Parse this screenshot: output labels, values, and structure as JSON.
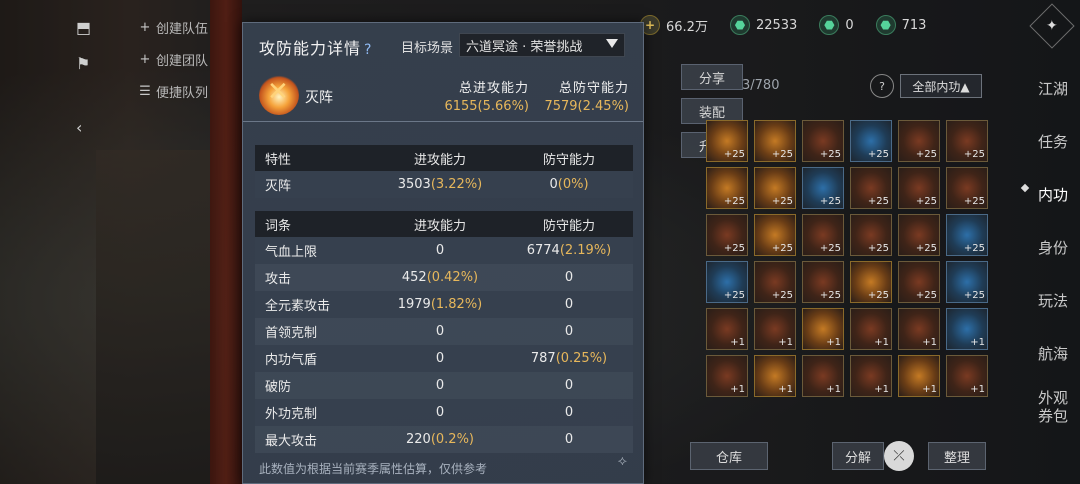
{
  "left_menu": [
    {
      "icon": "+",
      "label": "创建队伍"
    },
    {
      "icon": "+",
      "label": "创建团队"
    },
    {
      "icon": "☰",
      "label": "便捷队列"
    }
  ],
  "topbar": {
    "items": [
      {
        "icon": "+",
        "value": "66.2万"
      },
      {
        "icon": "⬣",
        "value": "22533"
      },
      {
        "icon": "⬣",
        "value": "0"
      },
      {
        "icon": "⬣",
        "value": "713"
      }
    ]
  },
  "right_nav": [
    "江湖",
    "任务",
    "内功",
    "身份",
    "玩法",
    "航海",
    "外观\n券包"
  ],
  "right_nav_active": 2,
  "inventory": {
    "side_buttons": [
      "分享",
      "装配",
      "升级"
    ],
    "count": "3/780",
    "help": "?",
    "filter": "全部内功▲",
    "slots": [
      {
        "t": "gold",
        "lv": "+25"
      },
      {
        "t": "gold",
        "lv": "+25"
      },
      {
        "t": "",
        "lv": "+25"
      },
      {
        "t": "blue",
        "lv": "+25"
      },
      {
        "t": "",
        "lv": "+25"
      },
      {
        "t": "",
        "lv": "+25"
      },
      {
        "t": "gold",
        "lv": "+25"
      },
      {
        "t": "gold",
        "lv": "+25"
      },
      {
        "t": "blue",
        "lv": "+25"
      },
      {
        "t": "",
        "lv": "+25"
      },
      {
        "t": "",
        "lv": "+25"
      },
      {
        "t": "",
        "lv": "+25"
      },
      {
        "t": "",
        "lv": "+25"
      },
      {
        "t": "gold",
        "lv": "+25"
      },
      {
        "t": "",
        "lv": "+25"
      },
      {
        "t": "",
        "lv": "+25"
      },
      {
        "t": "",
        "lv": "+25"
      },
      {
        "t": "blue",
        "lv": "+25"
      },
      {
        "t": "blue",
        "lv": "+25"
      },
      {
        "t": "",
        "lv": "+25"
      },
      {
        "t": "",
        "lv": "+25"
      },
      {
        "t": "gold",
        "lv": "+25"
      },
      {
        "t": "",
        "lv": "+25"
      },
      {
        "t": "blue",
        "lv": "+25"
      },
      {
        "t": "",
        "lv": "+1"
      },
      {
        "t": "",
        "lv": "+1"
      },
      {
        "t": "gold",
        "lv": "+1"
      },
      {
        "t": "",
        "lv": "+1"
      },
      {
        "t": "",
        "lv": "+1"
      },
      {
        "t": "blue",
        "lv": "+1"
      },
      {
        "t": "",
        "lv": "+1"
      },
      {
        "t": "gold",
        "lv": "+1"
      },
      {
        "t": "",
        "lv": "+1"
      },
      {
        "t": "",
        "lv": "+1"
      },
      {
        "t": "gold",
        "lv": "+1"
      },
      {
        "t": "",
        "lv": "+1"
      }
    ],
    "bottom": {
      "warehouse": "仓库",
      "decompose": "分解",
      "sort": "整理"
    }
  },
  "modal": {
    "title": "攻防能力详情",
    "title_help": "?",
    "scene_label": "目标场景",
    "scene_value": "六道冥途 · 荣誉挑战",
    "hero_name": "灭阵",
    "total_attack_label": "总进攻能力",
    "total_attack_value": "6155(5.66%)",
    "total_defense_label": "总防守能力",
    "total_defense_value": "7579(2.45%)",
    "table1": {
      "headers": [
        "特性",
        "进攻能力",
        "防守能力"
      ],
      "rows": [
        {
          "name": "灭阵",
          "atk": "3503",
          "atk_pct": "(3.22%)",
          "def": "0",
          "def_pct": "(0%)"
        }
      ]
    },
    "table2": {
      "headers": [
        "词条",
        "进攻能力",
        "防守能力"
      ],
      "rows": [
        {
          "name": "气血上限",
          "atk": "0",
          "atk_pct": "",
          "def": "6774",
          "def_pct": "(2.19%)"
        },
        {
          "name": "攻击",
          "atk": "452",
          "atk_pct": "(0.42%)",
          "def": "0",
          "def_pct": ""
        },
        {
          "name": "全元素攻击",
          "atk": "1979",
          "atk_pct": "(1.82%)",
          "def": "0",
          "def_pct": ""
        },
        {
          "name": "首领克制",
          "atk": "0",
          "atk_pct": "",
          "def": "0",
          "def_pct": ""
        },
        {
          "name": "内功气盾",
          "atk": "0",
          "atk_pct": "",
          "def": "787",
          "def_pct": "(0.25%)"
        },
        {
          "name": "破防",
          "atk": "0",
          "atk_pct": "",
          "def": "0",
          "def_pct": ""
        },
        {
          "name": "外功克制",
          "atk": "0",
          "atk_pct": "",
          "def": "0",
          "def_pct": ""
        },
        {
          "name": "最大攻击",
          "atk": "220",
          "atk_pct": "(0.2%)",
          "def": "0",
          "def_pct": ""
        }
      ]
    },
    "footnote": "此数值为根据当前赛季属性估算，仅供参考"
  }
}
